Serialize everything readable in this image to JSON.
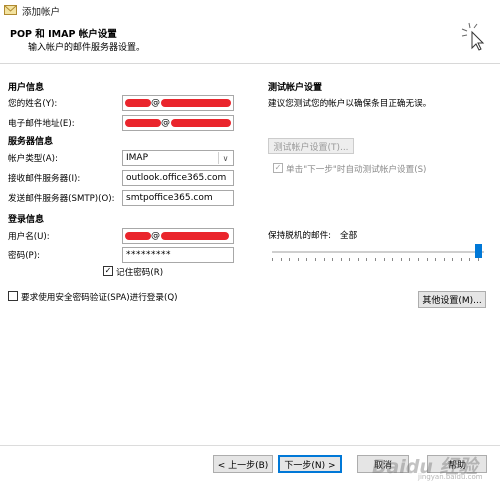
{
  "window": {
    "title": "添加帐户"
  },
  "header": {
    "title": "POP 和 IMAP 帐户设置",
    "subtitle": "输入帐户的邮件服务器设置。"
  },
  "user_info": {
    "section": "用户信息",
    "name_label": "您的姓名(Y):",
    "name_value": "@",
    "email_label": "电子邮件地址(E):",
    "email_value": "@"
  },
  "server_info": {
    "section": "服务器信息",
    "account_type_label": "帐户类型(A):",
    "account_type_value": "IMAP",
    "incoming_label": "接收邮件服务器(I):",
    "incoming_value": "outlook.office365.com",
    "outgoing_label": "发送邮件服务器(SMTP)(O):",
    "outgoing_value": "smtpoffice365.com"
  },
  "login_info": {
    "section": "登录信息",
    "username_label": "用户名(U):",
    "username_value": "@",
    "password_label": "密码(P):",
    "password_value": "*********",
    "remember_label": "记住密码(R)",
    "spa_label": "要求使用安全密码验证(SPA)进行登录(Q)"
  },
  "test_settings": {
    "section": "测试帐户设置",
    "desc": "建议您测试您的帐户以确保条目正确无误。",
    "test_button": "测试帐户设置(T)...",
    "auto_test_label": "单击\"下一步\"时自动测试帐户设置(S)"
  },
  "offline": {
    "label": "保持脱机的邮件:",
    "value": "全部",
    "level": 1.0
  },
  "buttons": {
    "more_settings": "其他设置(M)...",
    "back": "< 上一步(B)",
    "next": "下一步(N) >",
    "cancel": "取消",
    "help": "帮助"
  },
  "watermark": {
    "text": "Baidu 经验",
    "sub": "jingyan.baidu.com"
  },
  "colors": {
    "accent": "#0078d7",
    "redact": "#e8121a"
  }
}
